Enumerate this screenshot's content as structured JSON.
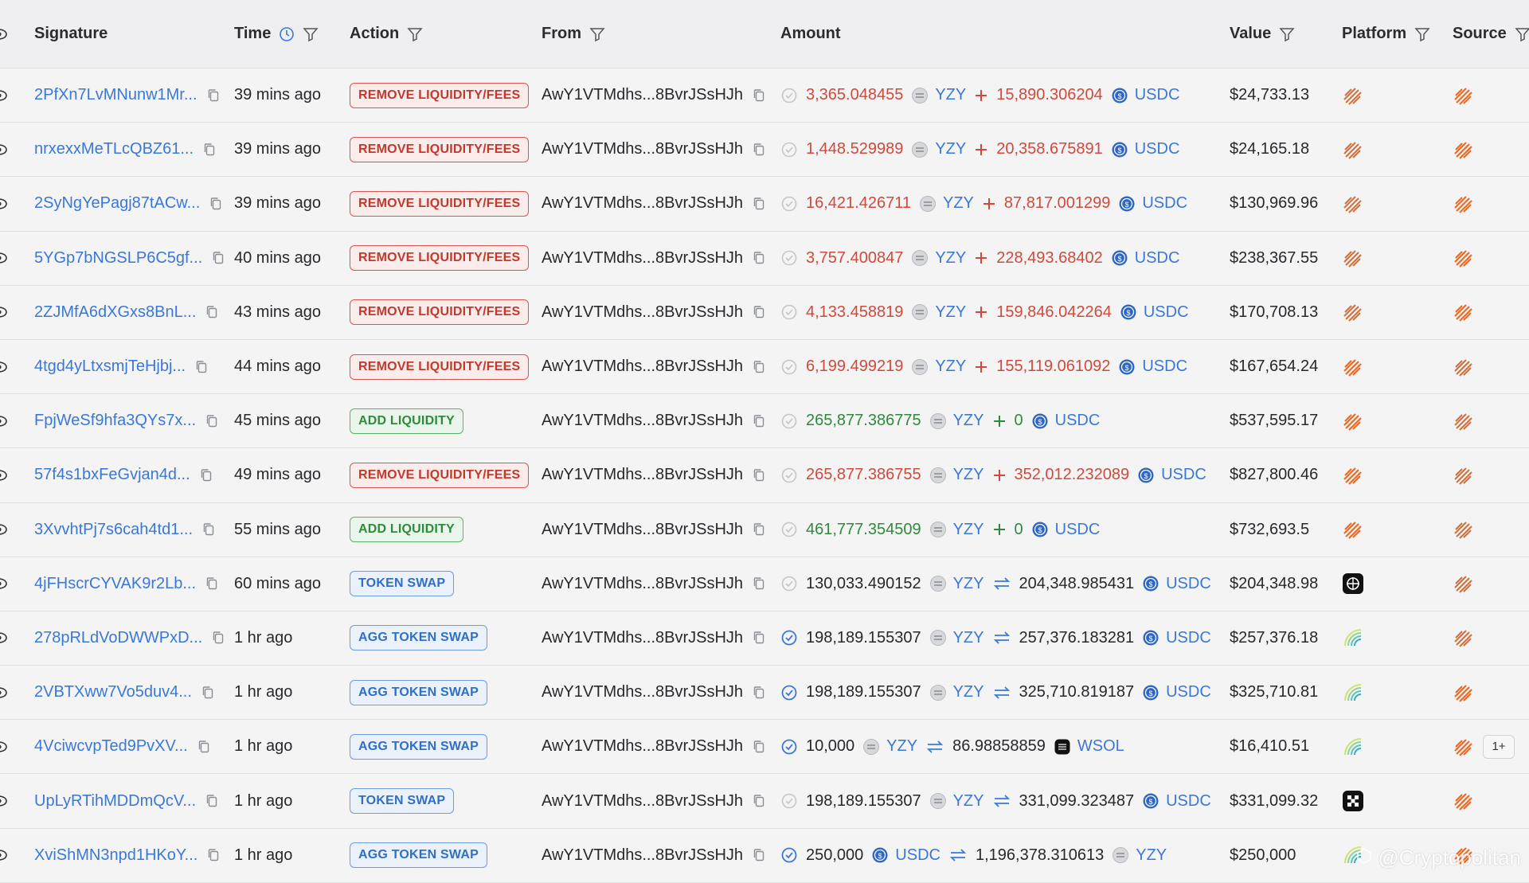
{
  "header": {
    "signature": "Signature",
    "time": "Time",
    "action": "Action",
    "from": "From",
    "amount": "Amount",
    "value": "Value",
    "platform": "Platform",
    "source": "Source"
  },
  "rows": [
    {
      "signature": "2PfXn7LvMNunw1Mr...",
      "time": "39 mins ago",
      "action": "REMOVE LIQUIDITY/FEES",
      "action_type": "remove",
      "from": "AwY1VTMdhs...8BvrJSsHJh",
      "status": "pending",
      "amt1": "3,365.048455",
      "tok1": "YZY",
      "tok1_icon": "yzy-icon",
      "op": "+",
      "amt2": "15,890.306204",
      "tok2": "USDC",
      "tok2_icon": "usdc-icon",
      "tone": "neg",
      "value": "$24,733.13",
      "platform": "striped-logo-icon"
    },
    {
      "signature": "nrxexxMeTLcQBZ61...",
      "time": "39 mins ago",
      "action": "REMOVE LIQUIDITY/FEES",
      "action_type": "remove",
      "from": "AwY1VTMdhs...8BvrJSsHJh",
      "status": "pending",
      "amt1": "1,448.529989",
      "tok1": "YZY",
      "tok1_icon": "yzy-icon",
      "op": "+",
      "amt2": "20,358.675891",
      "tok2": "USDC",
      "tok2_icon": "usdc-icon",
      "tone": "neg",
      "value": "$24,165.18",
      "platform": "striped-logo-icon"
    },
    {
      "signature": "2SyNgYePagj87tACw...",
      "time": "39 mins ago",
      "action": "REMOVE LIQUIDITY/FEES",
      "action_type": "remove",
      "from": "AwY1VTMdhs...8BvrJSsHJh",
      "status": "pending",
      "amt1": "16,421.426711",
      "tok1": "YZY",
      "tok1_icon": "yzy-icon",
      "op": "+",
      "amt2": "87,817.001299",
      "tok2": "USDC",
      "tok2_icon": "usdc-icon",
      "tone": "neg",
      "value": "$130,969.96",
      "platform": "striped-logo-icon"
    },
    {
      "signature": "5YGp7bNGSLP6C5gf...",
      "time": "40 mins ago",
      "action": "REMOVE LIQUIDITY/FEES",
      "action_type": "remove",
      "from": "AwY1VTMdhs...8BvrJSsHJh",
      "status": "pending",
      "amt1": "3,757.400847",
      "tok1": "YZY",
      "tok1_icon": "yzy-icon",
      "op": "+",
      "amt2": "228,493.68402",
      "tok2": "USDC",
      "tok2_icon": "usdc-icon",
      "tone": "neg",
      "value": "$238,367.55",
      "platform": "striped-logo-icon"
    },
    {
      "signature": "2ZJMfA6dXGxs8BnL...",
      "time": "43 mins ago",
      "action": "REMOVE LIQUIDITY/FEES",
      "action_type": "remove",
      "from": "AwY1VTMdhs...8BvrJSsHJh",
      "status": "pending",
      "amt1": "4,133.458819",
      "tok1": "YZY",
      "tok1_icon": "yzy-icon",
      "op": "+",
      "amt2": "159,846.042264",
      "tok2": "USDC",
      "tok2_icon": "usdc-icon",
      "tone": "neg",
      "value": "$170,708.13",
      "platform": "striped-logo-icon"
    },
    {
      "signature": "4tgd4yLtxsmjTeHjbj...",
      "time": "44 mins ago",
      "action": "REMOVE LIQUIDITY/FEES",
      "action_type": "remove",
      "from": "AwY1VTMdhs...8BvrJSsHJh",
      "status": "pending",
      "amt1": "6,199.499219",
      "tok1": "YZY",
      "tok1_icon": "yzy-icon",
      "op": "+",
      "amt2": "155,119.061092",
      "tok2": "USDC",
      "tok2_icon": "usdc-icon",
      "tone": "neg",
      "value": "$167,654.24",
      "platform": "striped-logo-icon"
    },
    {
      "signature": "FpjWeSf9hfa3QYs7x...",
      "time": "45 mins ago",
      "action": "ADD LIQUIDITY",
      "action_type": "add",
      "from": "AwY1VTMdhs...8BvrJSsHJh",
      "status": "pending",
      "amt1": "265,877.386775",
      "tok1": "YZY",
      "tok1_icon": "yzy-icon",
      "op": "+",
      "amt2": "0",
      "tok2": "USDC",
      "tok2_icon": "usdc-icon",
      "tone": "pos",
      "value": "$537,595.17",
      "platform": "striped-logo-icon"
    },
    {
      "signature": "57f4s1bxFeGvjan4d...",
      "time": "49 mins ago",
      "action": "REMOVE LIQUIDITY/FEES",
      "action_type": "remove",
      "from": "AwY1VTMdhs...8BvrJSsHJh",
      "status": "pending",
      "amt1": "265,877.386755",
      "tok1": "YZY",
      "tok1_icon": "yzy-icon",
      "op": "+",
      "amt2": "352,012.232089",
      "tok2": "USDC",
      "tok2_icon": "usdc-icon",
      "tone": "neg",
      "value": "$827,800.46",
      "platform": "striped-logo-icon"
    },
    {
      "signature": "3XvvhtPj7s6cah4td1...",
      "time": "55 mins ago",
      "action": "ADD LIQUIDITY",
      "action_type": "add",
      "from": "AwY1VTMdhs...8BvrJSsHJh",
      "status": "pending",
      "amt1": "461,777.354509",
      "tok1": "YZY",
      "tok1_icon": "yzy-icon",
      "op": "+",
      "amt2": "0",
      "tok2": "USDC",
      "tok2_icon": "usdc-icon",
      "tone": "pos",
      "value": "$732,693.5",
      "platform": "striped-logo-icon"
    },
    {
      "signature": "4jFHscrCYVAK9r2Lb...",
      "time": "60 mins ago",
      "action": "TOKEN SWAP",
      "action_type": "swap",
      "from": "AwY1VTMdhs...8BvrJSsHJh",
      "status": "pending",
      "amt1": "130,033.490152",
      "tok1": "YZY",
      "tok1_icon": "yzy-icon",
      "op": "swap",
      "amt2": "204,348.985431",
      "tok2": "USDC",
      "tok2_icon": "usdc-icon",
      "tone": "neu",
      "value": "$204,348.98",
      "platform": "dex-black-icon"
    },
    {
      "signature": "278pRLdVoDWWPxD...",
      "time": "1 hr ago",
      "action": "AGG TOKEN SWAP",
      "action_type": "swap",
      "from": "AwY1VTMdhs...8BvrJSsHJh",
      "status": "done",
      "amt1": "198,189.155307",
      "tok1": "YZY",
      "tok1_icon": "yzy-icon",
      "op": "swap",
      "amt2": "257,376.183281",
      "tok2": "USDC",
      "tok2_icon": "usdc-icon",
      "tone": "neu",
      "value": "$257,376.18",
      "platform": "aggregator-green-icon"
    },
    {
      "signature": "2VBTXww7Vo5duv4...",
      "time": "1 hr ago",
      "action": "AGG TOKEN SWAP",
      "action_type": "swap",
      "from": "AwY1VTMdhs...8BvrJSsHJh",
      "status": "done",
      "amt1": "198,189.155307",
      "tok1": "YZY",
      "tok1_icon": "yzy-icon",
      "op": "swap",
      "amt2": "325,710.819187",
      "tok2": "USDC",
      "tok2_icon": "usdc-icon",
      "tone": "neu",
      "value": "$325,710.81",
      "platform": "aggregator-green-icon"
    },
    {
      "signature": "4VciwcvpTed9PvXV...",
      "time": "1 hr ago",
      "action": "AGG TOKEN SWAP",
      "action_type": "swap",
      "from": "AwY1VTMdhs...8BvrJSsHJh",
      "status": "done",
      "amt1": "10,000",
      "tok1": "YZY",
      "tok1_icon": "yzy-icon",
      "op": "swap",
      "amt2": "86.98858859",
      "tok2": "WSOL",
      "tok2_icon": "wsol-icon",
      "tone": "neu",
      "value": "$16,410.51",
      "platform": "aggregator-green-icon",
      "more": "1+"
    },
    {
      "signature": "UpLyRTihMDDmQcV...",
      "time": "1 hr ago",
      "action": "TOKEN SWAP",
      "action_type": "swap",
      "from": "AwY1VTMdhs...8BvrJSsHJh",
      "status": "pending",
      "amt1": "198,189.155307",
      "tok1": "YZY",
      "tok1_icon": "yzy-icon",
      "op": "swap",
      "amt2": "331,099.323487",
      "tok2": "USDC",
      "tok2_icon": "usdc-icon",
      "tone": "neu",
      "value": "$331,099.32",
      "platform": "dex-grid-icon"
    },
    {
      "signature": "XviShMN3npd1HKoY...",
      "time": "1 hr ago",
      "action": "AGG TOKEN SWAP",
      "action_type": "swap",
      "from": "AwY1VTMdhs...8BvrJSsHJh",
      "status": "done",
      "amt1": "250,000",
      "tok1": "USDC",
      "tok1_icon": "usdc-icon",
      "op": "swap",
      "amt2": "1,196,378.310613",
      "tok2": "YZY",
      "tok2_icon": "yzy-icon",
      "tone": "neu",
      "value": "$250,000",
      "platform": "aggregator-green-icon"
    }
  ],
  "watermark": "@Cryptopolitan",
  "colors": {
    "link": "#3a78d8",
    "negative": "#d04a3c",
    "positive": "#2f8a3c",
    "background": "#f4f4f5"
  }
}
